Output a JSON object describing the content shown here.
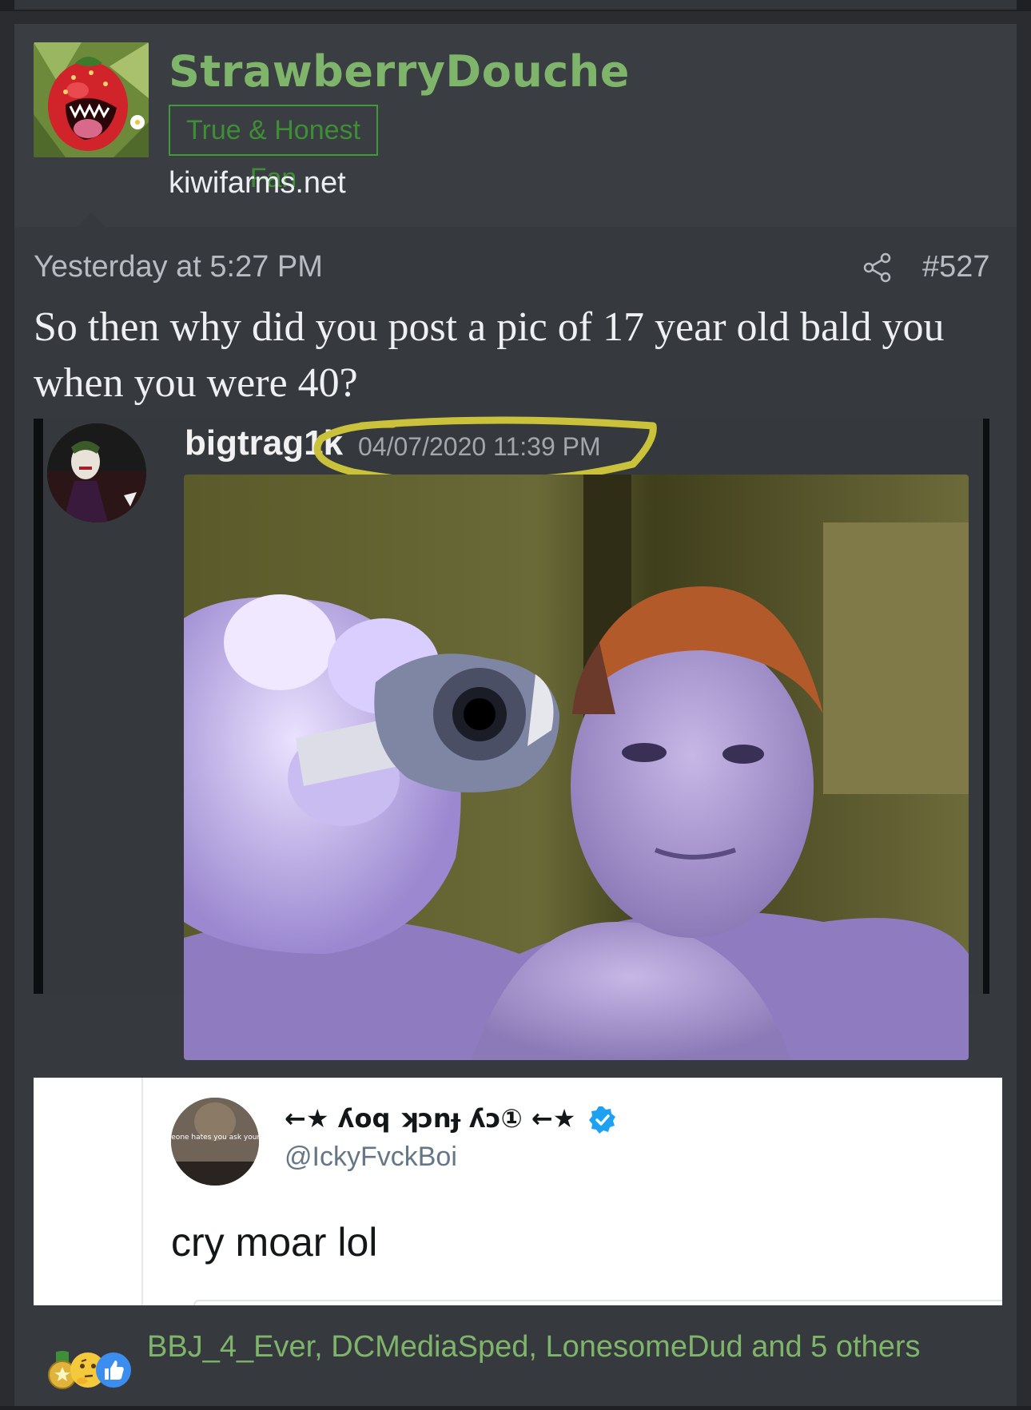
{
  "post": {
    "author": "StrawberryDouche",
    "user_title": "True & Honest Fan",
    "user_domain": "kiwifarms.net",
    "timestamp": "Yesterday at 5:27 PM",
    "post_number": "#527",
    "body": "So then why did you post a pic of 17 year old bald you when you were 40?"
  },
  "embedded_discord": {
    "username": "bigtrag1k",
    "timestamp": "04/07/2020 11:39 PM"
  },
  "embedded_tweet": {
    "display_name": "←★ ʎoq ʞɔnɟ ʎɔ① ←★",
    "handle": "@IckyFvckBoi",
    "avatar_caption": "Before you ask why someone hates you ask yourself why you give a fuck",
    "text": "cry moar lol"
  },
  "reactions": {
    "icons": [
      "medal-icon",
      "thinking-icon",
      "like-icon"
    ],
    "users_text": "BBJ_4_Ever, DCMediaSped, LonesomeDud and 5 others"
  },
  "colors": {
    "username_green": "#7fb56a",
    "title_green": "#3e8e35",
    "highlight_yellow": "#c9c23a",
    "verified_blue": "#1da1f2"
  }
}
